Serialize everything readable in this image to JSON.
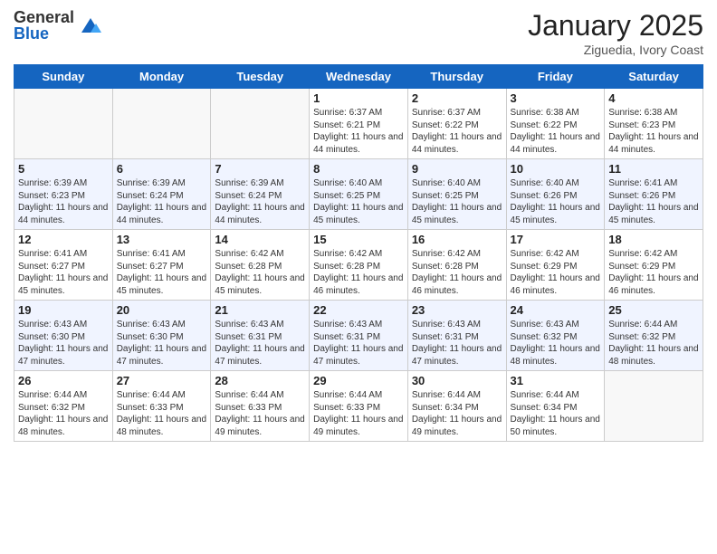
{
  "logo": {
    "general": "General",
    "blue": "Blue"
  },
  "title": "January 2025",
  "location": "Ziguedia, Ivory Coast",
  "days_of_week": [
    "Sunday",
    "Monday",
    "Tuesday",
    "Wednesday",
    "Thursday",
    "Friday",
    "Saturday"
  ],
  "weeks": [
    [
      {
        "day": "",
        "info": ""
      },
      {
        "day": "",
        "info": ""
      },
      {
        "day": "",
        "info": ""
      },
      {
        "day": "1",
        "info": "Sunrise: 6:37 AM\nSunset: 6:21 PM\nDaylight: 11 hours and 44 minutes."
      },
      {
        "day": "2",
        "info": "Sunrise: 6:37 AM\nSunset: 6:22 PM\nDaylight: 11 hours and 44 minutes."
      },
      {
        "day": "3",
        "info": "Sunrise: 6:38 AM\nSunset: 6:22 PM\nDaylight: 11 hours and 44 minutes."
      },
      {
        "day": "4",
        "info": "Sunrise: 6:38 AM\nSunset: 6:23 PM\nDaylight: 11 hours and 44 minutes."
      }
    ],
    [
      {
        "day": "5",
        "info": "Sunrise: 6:39 AM\nSunset: 6:23 PM\nDaylight: 11 hours and 44 minutes."
      },
      {
        "day": "6",
        "info": "Sunrise: 6:39 AM\nSunset: 6:24 PM\nDaylight: 11 hours and 44 minutes."
      },
      {
        "day": "7",
        "info": "Sunrise: 6:39 AM\nSunset: 6:24 PM\nDaylight: 11 hours and 44 minutes."
      },
      {
        "day": "8",
        "info": "Sunrise: 6:40 AM\nSunset: 6:25 PM\nDaylight: 11 hours and 45 minutes."
      },
      {
        "day": "9",
        "info": "Sunrise: 6:40 AM\nSunset: 6:25 PM\nDaylight: 11 hours and 45 minutes."
      },
      {
        "day": "10",
        "info": "Sunrise: 6:40 AM\nSunset: 6:26 PM\nDaylight: 11 hours and 45 minutes."
      },
      {
        "day": "11",
        "info": "Sunrise: 6:41 AM\nSunset: 6:26 PM\nDaylight: 11 hours and 45 minutes."
      }
    ],
    [
      {
        "day": "12",
        "info": "Sunrise: 6:41 AM\nSunset: 6:27 PM\nDaylight: 11 hours and 45 minutes."
      },
      {
        "day": "13",
        "info": "Sunrise: 6:41 AM\nSunset: 6:27 PM\nDaylight: 11 hours and 45 minutes."
      },
      {
        "day": "14",
        "info": "Sunrise: 6:42 AM\nSunset: 6:28 PM\nDaylight: 11 hours and 45 minutes."
      },
      {
        "day": "15",
        "info": "Sunrise: 6:42 AM\nSunset: 6:28 PM\nDaylight: 11 hours and 46 minutes."
      },
      {
        "day": "16",
        "info": "Sunrise: 6:42 AM\nSunset: 6:28 PM\nDaylight: 11 hours and 46 minutes."
      },
      {
        "day": "17",
        "info": "Sunrise: 6:42 AM\nSunset: 6:29 PM\nDaylight: 11 hours and 46 minutes."
      },
      {
        "day": "18",
        "info": "Sunrise: 6:42 AM\nSunset: 6:29 PM\nDaylight: 11 hours and 46 minutes."
      }
    ],
    [
      {
        "day": "19",
        "info": "Sunrise: 6:43 AM\nSunset: 6:30 PM\nDaylight: 11 hours and 47 minutes."
      },
      {
        "day": "20",
        "info": "Sunrise: 6:43 AM\nSunset: 6:30 PM\nDaylight: 11 hours and 47 minutes."
      },
      {
        "day": "21",
        "info": "Sunrise: 6:43 AM\nSunset: 6:31 PM\nDaylight: 11 hours and 47 minutes."
      },
      {
        "day": "22",
        "info": "Sunrise: 6:43 AM\nSunset: 6:31 PM\nDaylight: 11 hours and 47 minutes."
      },
      {
        "day": "23",
        "info": "Sunrise: 6:43 AM\nSunset: 6:31 PM\nDaylight: 11 hours and 47 minutes."
      },
      {
        "day": "24",
        "info": "Sunrise: 6:43 AM\nSunset: 6:32 PM\nDaylight: 11 hours and 48 minutes."
      },
      {
        "day": "25",
        "info": "Sunrise: 6:44 AM\nSunset: 6:32 PM\nDaylight: 11 hours and 48 minutes."
      }
    ],
    [
      {
        "day": "26",
        "info": "Sunrise: 6:44 AM\nSunset: 6:32 PM\nDaylight: 11 hours and 48 minutes."
      },
      {
        "day": "27",
        "info": "Sunrise: 6:44 AM\nSunset: 6:33 PM\nDaylight: 11 hours and 48 minutes."
      },
      {
        "day": "28",
        "info": "Sunrise: 6:44 AM\nSunset: 6:33 PM\nDaylight: 11 hours and 49 minutes."
      },
      {
        "day": "29",
        "info": "Sunrise: 6:44 AM\nSunset: 6:33 PM\nDaylight: 11 hours and 49 minutes."
      },
      {
        "day": "30",
        "info": "Sunrise: 6:44 AM\nSunset: 6:34 PM\nDaylight: 11 hours and 49 minutes."
      },
      {
        "day": "31",
        "info": "Sunrise: 6:44 AM\nSunset: 6:34 PM\nDaylight: 11 hours and 50 minutes."
      },
      {
        "day": "",
        "info": ""
      }
    ]
  ]
}
